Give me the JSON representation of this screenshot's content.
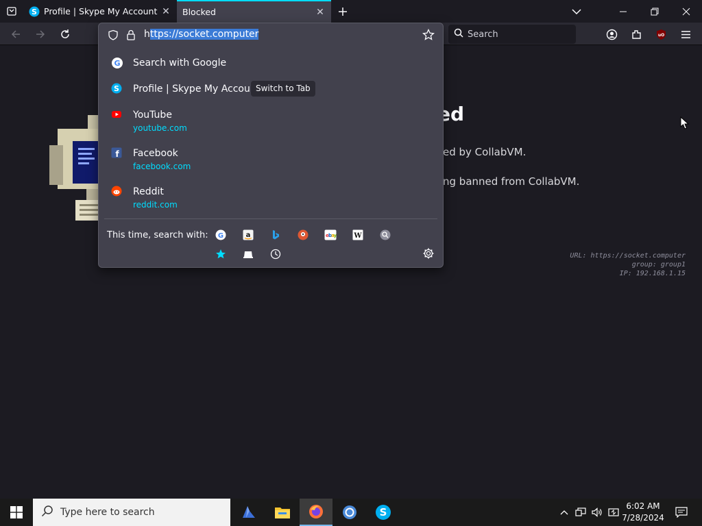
{
  "tabs": [
    {
      "title": "Profile | Skype My Account",
      "favicon": "skype-icon",
      "active": false
    },
    {
      "title": "Blocked",
      "favicon": "none",
      "active": true
    }
  ],
  "toolbar": {
    "url_prefix": "h",
    "url_selected": "ttps://socket.computer",
    "search_placeholder": "Search"
  },
  "dropdown": {
    "results": [
      {
        "title": "Search with Google",
        "url": "",
        "icon": "google-icon"
      },
      {
        "title": "Profile | Skype My Account",
        "url": "",
        "icon": "skype-icon",
        "action": "Switch to Tab"
      },
      {
        "title": "YouTube",
        "url": "youtube.com",
        "icon": "youtube-icon"
      },
      {
        "title": "Facebook",
        "url": "facebook.com",
        "icon": "facebook-icon"
      },
      {
        "title": "Reddit",
        "url": "reddit.com",
        "icon": "reddit-icon"
      }
    ],
    "oneoff_label": "This time, search with:",
    "engines": [
      "google",
      "amazon",
      "bing",
      "duckduckgo",
      "ebay",
      "wikipedia",
      "search",
      "bookmarks",
      "tabs",
      "history"
    ]
  },
  "page": {
    "title_fragment": "ed",
    "line1": "ed by CollabVM.",
    "line2": "ng banned from CollabVM.",
    "meta_url": "URL: https://socket.computer",
    "meta_group": "group: group1",
    "meta_ip": "IP: 192.168.1.15"
  },
  "taskbar": {
    "search_placeholder": "Type here to search",
    "time": "6:02 AM",
    "date": "7/28/2024"
  },
  "colors": {
    "accent": "#00ddff",
    "panel": "#42414d",
    "background": "#1c1b22",
    "selection": "#3b7bd6"
  }
}
